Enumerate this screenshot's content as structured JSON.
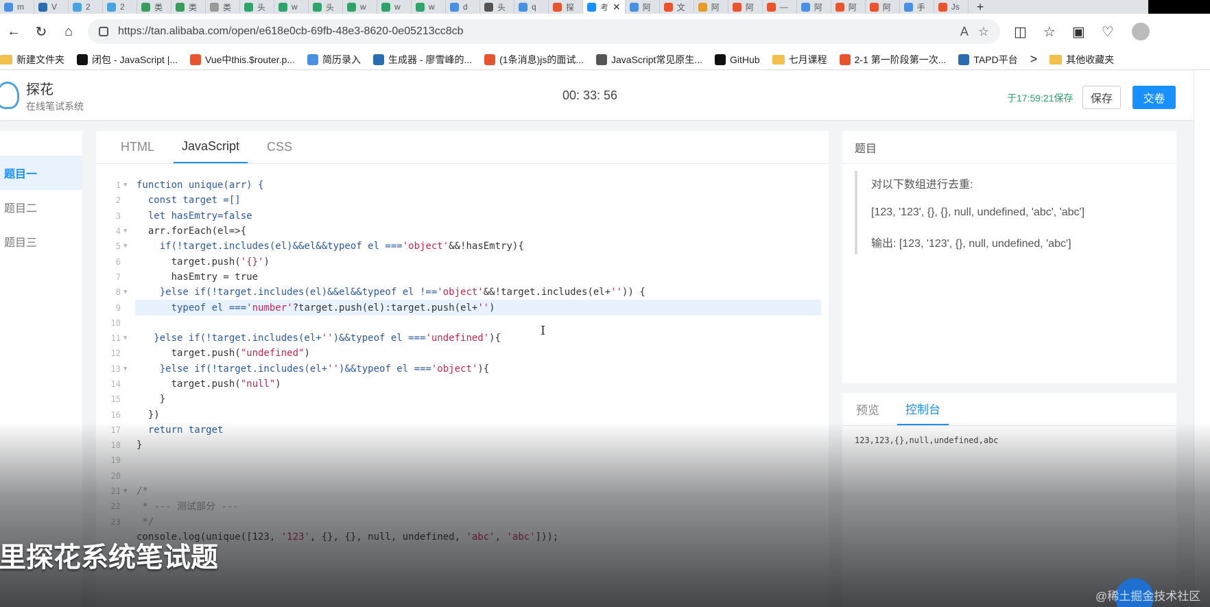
{
  "browser": {
    "tabs": [
      {
        "label": "m",
        "color": "#4a90e2"
      },
      {
        "label": "V",
        "color": "#2b6cb0"
      },
      {
        "label": "2",
        "color": "#4aa3df"
      },
      {
        "label": "2",
        "color": "#4aa3df"
      },
      {
        "label": "类",
        "color": "#3a9d5d"
      },
      {
        "label": "类",
        "color": "#3a9d5d"
      },
      {
        "label": "类",
        "color": "#999999"
      },
      {
        "label": "头",
        "color": "#2fa36b"
      },
      {
        "label": "w",
        "color": "#2fa36b"
      },
      {
        "label": "头",
        "color": "#2fa36b"
      },
      {
        "label": "w",
        "color": "#2fa36b"
      },
      {
        "label": "w",
        "color": "#2fa36b"
      },
      {
        "label": "w",
        "color": "#2fa36b"
      },
      {
        "label": "d",
        "color": "#4a90e2"
      },
      {
        "label": "头",
        "color": "#555555"
      },
      {
        "label": "q",
        "color": "#4a90e2"
      },
      {
        "label": "探",
        "color": "#e8542e"
      },
      {
        "label": "考",
        "color": "#1890ff"
      },
      {
        "label": "阿",
        "color": "#4a90e2"
      },
      {
        "label": "文",
        "color": "#e8542e"
      },
      {
        "label": "阿",
        "color": "#e89a2e"
      },
      {
        "label": "阿",
        "color": "#e8542e"
      },
      {
        "label": "—",
        "color": "#e8542e"
      },
      {
        "label": "阿",
        "color": "#4a90e2"
      },
      {
        "label": "阿",
        "color": "#e8542e"
      },
      {
        "label": "阿",
        "color": "#e8542e"
      },
      {
        "label": "手",
        "color": "#4a90e2"
      },
      {
        "label": "Js",
        "color": "#e8542e"
      }
    ],
    "new_tab": "+",
    "url": "https://tan.alibaba.com/open/e618e0cb-69fb-48e3-8620-0e05213cc8cb"
  },
  "bookmarks": {
    "items": [
      {
        "label": "新建文件夹",
        "color": "#f2c04b"
      },
      {
        "label": "闭包 - JavaScript |...",
        "color": "#111111"
      },
      {
        "label": "Vue中this.$router.p...",
        "color": "#e8542e"
      },
      {
        "label": "简历录入",
        "color": "#4a90e2"
      },
      {
        "label": "生成器 - 廖雪峰的...",
        "color": "#2b6cb0"
      },
      {
        "label": "(1条消息)js的面试...",
        "color": "#e8542e"
      },
      {
        "label": "JavaScript常见原生...",
        "color": "#555555"
      },
      {
        "label": "GitHub",
        "color": "#111111"
      },
      {
        "label": "七月课程",
        "color": "#f2c04b"
      },
      {
        "label": "2-1 第一阶段第一次...",
        "color": "#e8542e"
      },
      {
        "label": "TAPD平台",
        "color": "#2b6cb0"
      }
    ],
    "more": ">",
    "other_folder": "其他收藏夹"
  },
  "app": {
    "name": "探花",
    "subtitle": "在线笔试系统",
    "timer": "00: 33: 56",
    "saved_status": "于17:59:21保存",
    "save_label": "保存",
    "submit_label": "交卷",
    "accent": "#1890ff"
  },
  "leftnav": {
    "items": [
      {
        "label": "题目一",
        "active": true
      },
      {
        "label": "题目二",
        "active": false
      },
      {
        "label": "题目三",
        "active": false
      }
    ]
  },
  "editor": {
    "tabs": [
      {
        "label": "HTML",
        "active": false
      },
      {
        "label": "JavaScript",
        "active": true
      },
      {
        "label": "CSS",
        "active": false
      }
    ],
    "highlighted_line": 9,
    "lines": [
      {
        "n": "1",
        "fold": true,
        "tokens": [
          [
            "function unique(arr) {",
            "kw"
          ]
        ]
      },
      {
        "n": "2",
        "fold": false,
        "tokens": [
          [
            "  const target =[]",
            "kw"
          ]
        ]
      },
      {
        "n": "3",
        "fold": false,
        "tokens": [
          [
            "  let hasEmtry=false",
            "kw"
          ]
        ]
      },
      {
        "n": "4",
        "fold": true,
        "tokens": [
          [
            "  arr.forEach(el=>{",
            "plain"
          ]
        ]
      },
      {
        "n": "5",
        "fold": true,
        "tokens": [
          [
            "    if(!target.includes(el)&&el&&typeof el ===",
            "kw"
          ],
          [
            "'object'",
            "str"
          ],
          [
            "&&!hasEmtry){",
            "plain"
          ]
        ]
      },
      {
        "n": "6",
        "fold": false,
        "tokens": [
          [
            "      target.push(",
            "plain"
          ],
          [
            "'{}'",
            "str"
          ],
          [
            ")",
            "plain"
          ]
        ]
      },
      {
        "n": "7",
        "fold": false,
        "tokens": [
          [
            "      hasEmtry = true",
            "plain"
          ]
        ]
      },
      {
        "n": "8",
        "fold": true,
        "tokens": [
          [
            "    }else if(!target.includes(el)&&el&&typeof el !==",
            "kw"
          ],
          [
            "'object'",
            "str"
          ],
          [
            "&&!target.includes(el+",
            "plain"
          ],
          [
            "''",
            "str"
          ],
          [
            ")) {",
            "plain"
          ]
        ]
      },
      {
        "n": "9",
        "fold": false,
        "tokens": [
          [
            "      typeof el ===",
            "kw"
          ],
          [
            "'number'",
            "str"
          ],
          [
            "?target.push(el):target.push(el+",
            "plain"
          ],
          [
            "''",
            "str"
          ],
          [
            ")",
            "plain"
          ]
        ]
      },
      {
        "n": "10",
        "fold": false,
        "tokens": [
          [
            "",
            "plain"
          ]
        ]
      },
      {
        "n": "11",
        "fold": true,
        "tokens": [
          [
            "   }else if(!target.includes(el+",
            "kw"
          ],
          [
            "''",
            "str"
          ],
          [
            ")&&typeof el ===",
            "kw"
          ],
          [
            "'undefined'",
            "str"
          ],
          [
            "){",
            "plain"
          ]
        ]
      },
      {
        "n": "12",
        "fold": false,
        "tokens": [
          [
            "      target.push(",
            "plain"
          ],
          [
            "\"undefined\"",
            "str"
          ],
          [
            ")",
            "plain"
          ]
        ]
      },
      {
        "n": "13",
        "fold": true,
        "tokens": [
          [
            "    }else if(!target.includes(el+",
            "kw"
          ],
          [
            "''",
            "str"
          ],
          [
            ")&&typeof el ===",
            "kw"
          ],
          [
            "'object'",
            "str"
          ],
          [
            "){",
            "plain"
          ]
        ]
      },
      {
        "n": "14",
        "fold": false,
        "tokens": [
          [
            "      target.push(",
            "plain"
          ],
          [
            "\"null\"",
            "str"
          ],
          [
            ")",
            "plain"
          ]
        ]
      },
      {
        "n": "15",
        "fold": false,
        "tokens": [
          [
            "    }",
            "plain"
          ]
        ]
      },
      {
        "n": "16",
        "fold": false,
        "tokens": [
          [
            "  })",
            "plain"
          ]
        ]
      },
      {
        "n": "17",
        "fold": false,
        "tokens": [
          [
            "  return target",
            "kw"
          ]
        ]
      },
      {
        "n": "18",
        "fold": false,
        "tokens": [
          [
            "}",
            "plain"
          ]
        ]
      },
      {
        "n": "19",
        "fold": false,
        "tokens": [
          [
            "",
            "plain"
          ]
        ]
      },
      {
        "n": "20",
        "fold": false,
        "tokens": [
          [
            "",
            "plain"
          ]
        ]
      },
      {
        "n": "21",
        "fold": true,
        "tokens": [
          [
            "/*",
            "cm"
          ]
        ]
      },
      {
        "n": "22",
        "fold": false,
        "tokens": [
          [
            " * --- 测试部分 ---",
            "cm"
          ]
        ]
      },
      {
        "n": "23",
        "fold": false,
        "tokens": [
          [
            " */",
            "cm"
          ]
        ]
      },
      {
        "n": "",
        "fold": false,
        "tokens": [
          [
            "console.log(unique([123, ",
            "plain"
          ],
          [
            "'123'",
            "str"
          ],
          [
            ", {}, {}, null, undefined, ",
            "plain"
          ],
          [
            "'abc'",
            "str"
          ],
          [
            ", ",
            "plain"
          ],
          [
            "'abc'",
            "str"
          ],
          [
            "]));",
            "plain"
          ]
        ]
      }
    ]
  },
  "question": {
    "heading": "题目",
    "lines": [
      "对以下数组进行去重:",
      "[123, '123', {}, {}, null, undefined, 'abc', 'abc']",
      "输出: [123, '123', {}, null, undefined, 'abc']"
    ]
  },
  "console": {
    "tabs": [
      {
        "label": "预览",
        "active": false
      },
      {
        "label": "控制台",
        "active": true
      }
    ],
    "output": "123,123,{},null,undefined,abc"
  },
  "video": {
    "subtitle": "里探花系统笔试题",
    "watermark": "@稀土掘金技术社区"
  },
  "syntax_colors": {
    "kw": "#2c5aa0",
    "str": "#c7254e",
    "plain": "#333333",
    "cm": "#999999"
  }
}
